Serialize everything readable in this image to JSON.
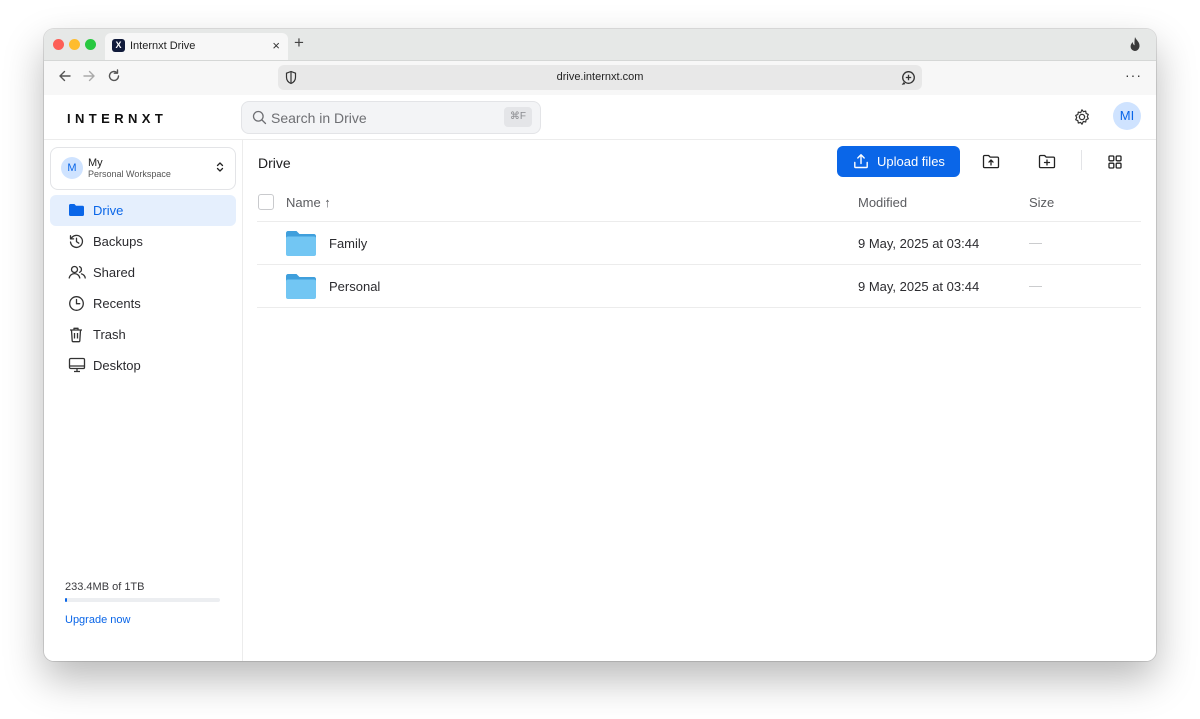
{
  "browser": {
    "tab_title": "Internxt Drive",
    "tab_favicon_letter": "X",
    "tab_close": "×",
    "new_tab": "+",
    "url": "drive.internxt.com",
    "menu": "···",
    "icons": [
      "back-icon",
      "forward-icon",
      "reload-icon",
      "shield-icon",
      "add-to-page-icon",
      "flame-icon"
    ]
  },
  "header": {
    "logo": "INTERNXT",
    "search_placeholder": "Search in Drive",
    "search_shortcut": "⌘F",
    "avatar_initials": "MI"
  },
  "sidebar": {
    "workspace": {
      "initial": "M",
      "name": "My",
      "subtitle": "Personal Workspace"
    },
    "items": [
      {
        "label": "Drive",
        "icon": "folder-icon",
        "active": true
      },
      {
        "label": "Backups",
        "icon": "history-icon",
        "active": false
      },
      {
        "label": "Shared",
        "icon": "users-icon",
        "active": false
      },
      {
        "label": "Recents",
        "icon": "clock-icon",
        "active": false
      },
      {
        "label": "Trash",
        "icon": "trash-icon",
        "active": false
      },
      {
        "label": "Desktop",
        "icon": "desktop-icon",
        "active": false
      }
    ],
    "usage_text": "233.4MB of 1TB",
    "usage_fraction": 0.0002,
    "upgrade_label": "Upgrade now"
  },
  "main": {
    "title": "Drive",
    "upload_label": "Upload files",
    "columns": {
      "name": "Name ↑",
      "modified": "Modified",
      "size": "Size"
    },
    "rows": [
      {
        "name": "Family",
        "modified": "9 May, 2025 at 03:44",
        "size": "—"
      },
      {
        "name": "Personal",
        "modified": "9 May, 2025 at 03:44",
        "size": "—"
      }
    ]
  },
  "colors": {
    "accent": "#0a66e8",
    "active_nav_bg": "#e5effd",
    "folder": "#6cc3f2"
  }
}
